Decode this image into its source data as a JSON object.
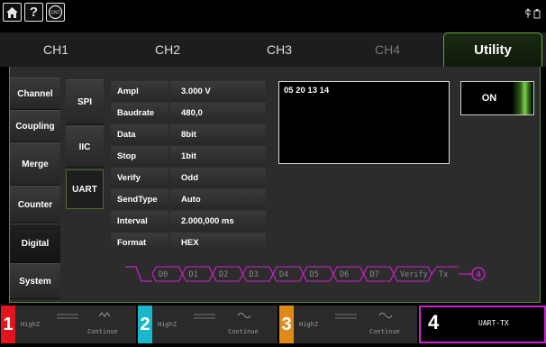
{
  "topbar": {
    "home_icon": "home-icon",
    "help_icon": "help-icon",
    "cnt_icon": "cnt-icon",
    "usb_icon": "usb-icon",
    "cnt_label": "CNT"
  },
  "tabs": [
    {
      "label": "CH1"
    },
    {
      "label": "CH2"
    },
    {
      "label": "CH3"
    },
    {
      "label": "CH4"
    },
    {
      "label": "Utility"
    }
  ],
  "sidebar": [
    {
      "label": "Channel"
    },
    {
      "label": "Coupling"
    },
    {
      "label": "Merge"
    },
    {
      "label": "Counter"
    },
    {
      "label": "Digital"
    },
    {
      "label": "System"
    }
  ],
  "protocols": [
    {
      "label": "SPI"
    },
    {
      "label": "IIC"
    },
    {
      "label": "UART"
    }
  ],
  "params": [
    {
      "label": "Ampl",
      "value": "3.000 V"
    },
    {
      "label": "Baudrate",
      "value": "480,0"
    },
    {
      "label": "Data",
      "value": "8bit"
    },
    {
      "label": "Stop",
      "value": "1bit"
    },
    {
      "label": "Verify",
      "value": "Odd"
    },
    {
      "label": "SendType",
      "value": "Auto"
    },
    {
      "label": "Interval",
      "value": "2.000,000 ms"
    },
    {
      "label": "Format",
      "value": "HEX"
    }
  ],
  "data_window": {
    "text": "05 20 13 14"
  },
  "toggle": {
    "label": "ON"
  },
  "timing": {
    "bits": [
      "D0",
      "D1",
      "D2",
      "D3",
      "D4",
      "D5",
      "D6",
      "D7",
      "Verify"
    ],
    "tx_label": "Tx",
    "channel_marker": "4",
    "color": "#d020d0"
  },
  "channels": [
    {
      "num": "1",
      "load": "HighZ",
      "mode": "Continue",
      "color": "#e0151e"
    },
    {
      "num": "2",
      "load": "HighZ",
      "mode": "Continue",
      "color": "#18b7c9"
    },
    {
      "num": "3",
      "load": "HighZ",
      "mode": "Continue",
      "color": "#e08a1a"
    },
    {
      "num": "4",
      "mode": "UART-TX",
      "color": "#d020d0"
    }
  ]
}
